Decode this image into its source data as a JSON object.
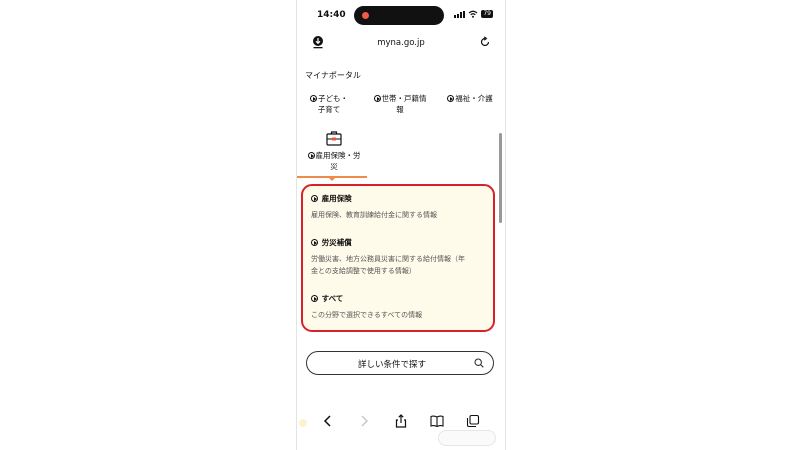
{
  "status_bar": {
    "time": "14:40",
    "battery": "79"
  },
  "browser": {
    "url": "myna.go.jp"
  },
  "breadcrumb": "マイナポータル",
  "categories": [
    {
      "label_line1": "子ども・",
      "label_line2": "子育て"
    },
    {
      "label_line1": "世帯・戸籍情",
      "label_line2": "報"
    },
    {
      "label_line1": "福祉・介護",
      "label_line2": ""
    }
  ],
  "selected_category": {
    "label_line1": "雇用保険・労",
    "label_line2": "災"
  },
  "panel": {
    "items": [
      {
        "title": "雇用保険",
        "desc_line1": "雇用保険、教育訓練給付金に関する情報",
        "desc_line2": ""
      },
      {
        "title": "労災補償",
        "desc_line1": "労働災害、地方公務員災害に関する給付情報（年",
        "desc_line2": "金との支給調整で使用する情報）"
      },
      {
        "title": "すべて",
        "desc_line1": "この分野で選択できるすべての情報",
        "desc_line2": ""
      }
    ],
    "highlight_color": "#d8222a",
    "background_color": "#fffbea"
  },
  "search_button": {
    "label": "詳しい条件で探す"
  },
  "accent_color": "#f08a4b"
}
